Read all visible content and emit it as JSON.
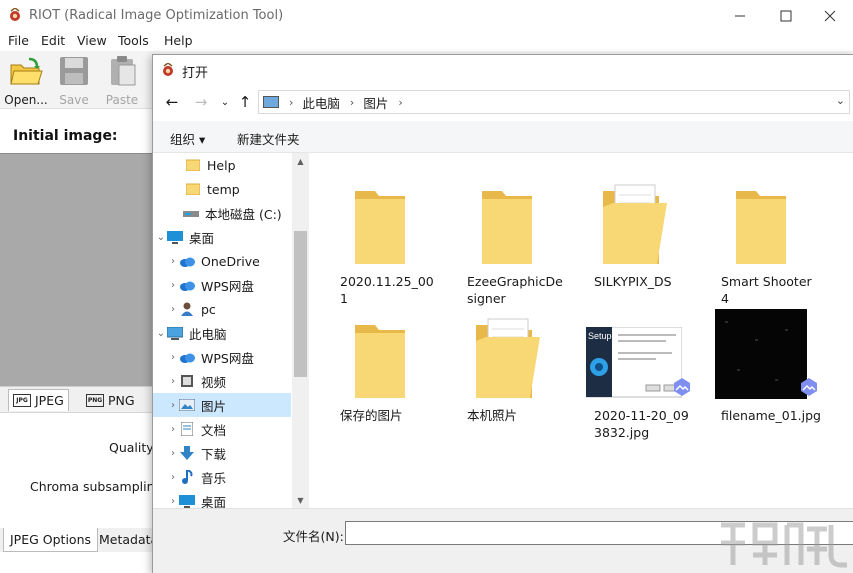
{
  "app": {
    "title": "RIOT (Radical Image Optimization Tool)",
    "menu": [
      "File",
      "Edit",
      "View",
      "Tools",
      "Help"
    ],
    "toolbar": {
      "open_label": "Open...",
      "save_label": "Save",
      "paste_label": "Paste"
    },
    "initial_image_label": "Initial image:",
    "format_tabs": [
      "JPEG",
      "PNG"
    ],
    "quality_label": "Quality:",
    "chroma_label": "Chroma subsampling",
    "bottom_tabs": [
      "JPEG Options",
      "Metadata"
    ]
  },
  "dialog": {
    "title": "打开",
    "breadcrumb": [
      "此电脑",
      "图片"
    ],
    "commands": {
      "organize": "组织 ▾",
      "new_folder": "新建文件夹"
    },
    "tree": [
      {
        "label": "Help",
        "icon": "folder-icon",
        "expander": ""
      },
      {
        "label": "temp",
        "icon": "folder-icon",
        "expander": ""
      },
      {
        "label": "本地磁盘 (C:)",
        "icon": "drive-icon",
        "expander": ""
      },
      {
        "label": "桌面",
        "icon": "desktop-icon",
        "expander": "⌄"
      },
      {
        "label": "OneDrive",
        "icon": "cloud-icon",
        "expander": "›"
      },
      {
        "label": "WPS网盘",
        "icon": "cloud-icon",
        "expander": "›"
      },
      {
        "label": "pc",
        "icon": "user-icon",
        "expander": "›"
      },
      {
        "label": "此电脑",
        "icon": "computer-icon",
        "expander": "⌄"
      },
      {
        "label": "WPS网盘",
        "icon": "cloud-icon",
        "expander": "›"
      },
      {
        "label": "视频",
        "icon": "video-icon",
        "expander": "›"
      },
      {
        "label": "图片",
        "icon": "pictures-icon",
        "expander": "›",
        "selected": true
      },
      {
        "label": "文档",
        "icon": "document-icon",
        "expander": "›"
      },
      {
        "label": "下载",
        "icon": "download-icon",
        "expander": "›"
      },
      {
        "label": "音乐",
        "icon": "music-icon",
        "expander": "›"
      },
      {
        "label": "桌面",
        "icon": "desktop-icon",
        "expander": "›"
      }
    ],
    "items": [
      {
        "name": "2020.11.25_001",
        "kind": "folder"
      },
      {
        "name": "EzeeGraphicDesigner",
        "kind": "folder"
      },
      {
        "name": "SILKYPIX_DS",
        "kind": "folder-doc"
      },
      {
        "name": "Smart Shooter 4",
        "kind": "folder"
      },
      {
        "name": "保存的图片",
        "kind": "folder"
      },
      {
        "name": "本机照片",
        "kind": "folder-doc"
      },
      {
        "name": "2020-11-20_093832.jpg",
        "kind": "image-setup"
      },
      {
        "name": "filename_01.jpg",
        "kind": "image-dark"
      }
    ],
    "filename_label": "文件名(N):",
    "filename_value": ""
  }
}
